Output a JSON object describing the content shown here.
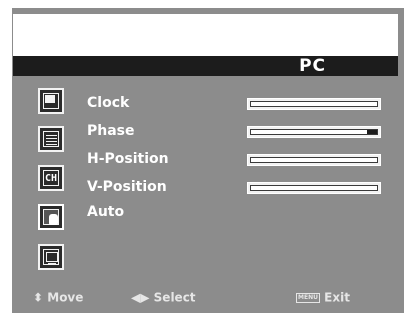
{
  "osd": {
    "header_title": "PC",
    "menu_items": [
      {
        "label": "Clock",
        "value_pct": 100
      },
      {
        "label": "Phase",
        "value_pct": 92
      },
      {
        "label": "H-Position",
        "value_pct": 100
      },
      {
        "label": "V-Position",
        "value_pct": 100
      },
      {
        "label": "Auto"
      }
    ],
    "side_icons": [
      "picture-icon",
      "sound-icon",
      "channel-icon",
      "pc-setup-icon",
      "function-icon"
    ],
    "footer": {
      "move_label": "Move",
      "select_label": "Select",
      "exit_label": "Exit",
      "menu_badge": "MENU"
    }
  }
}
